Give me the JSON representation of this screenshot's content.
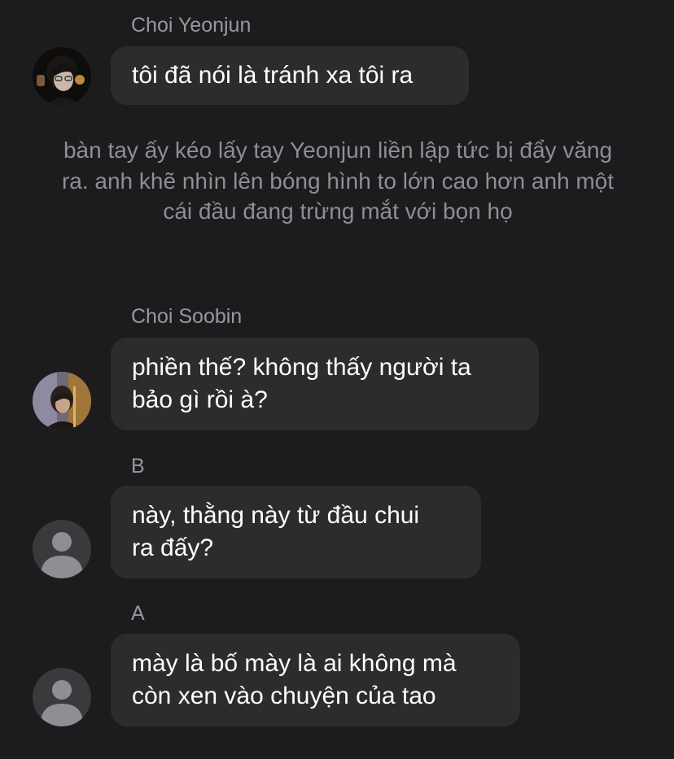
{
  "messages": [
    {
      "sender": "Choi Yeonjun",
      "text": "tôi đã nói là tránh xa tôi ra",
      "avatar": "photo-avatar-yeonjun"
    },
    {
      "sender": "Choi Soobin",
      "text": "phiền thế? không thấy người ta\nbảo gì rồi à?",
      "avatar": "photo-avatar-soobin"
    },
    {
      "sender": "B",
      "text": "này, thằng này từ đầu chui\nra đấy?",
      "avatar": "default-person-icon"
    },
    {
      "sender": "A",
      "text": "mày là bố mày là ai không mà\ncòn xen vào chuyện của tao",
      "avatar": "default-person-icon"
    }
  ],
  "narration": "bàn tay ấy kéo lấy tay Yeonjun liền lập tức bị đẩy văng ra. anh khẽ nhìn lên bóng hình to lớn cao hơn anh một cái đầu đang trừng mắt với bọn họ",
  "colors": {
    "background": "#1c1c1e",
    "bubble": "#2c2c2e",
    "sender_text": "#98989d",
    "narration_text": "#8e8e93",
    "message_text": "#ffffff"
  }
}
